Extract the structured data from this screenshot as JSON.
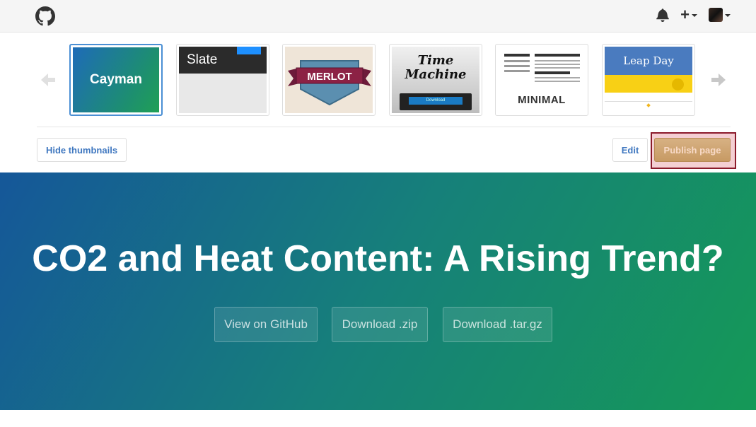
{
  "nav": {
    "logo_icon": "github-octocat-icon",
    "notifications_icon": "bell-icon",
    "new_icon": "plus-icon",
    "avatar_icon": "user-avatar"
  },
  "theme_chooser": {
    "themes": [
      {
        "name": "Cayman",
        "selected": true
      },
      {
        "name": "Slate",
        "selected": false
      },
      {
        "name": "MERLOT",
        "selected": false
      },
      {
        "name_line1": "Time",
        "name_line2": "Machine",
        "button_label": "Download",
        "selected": false
      },
      {
        "name": "MINIMAL",
        "selected": false
      },
      {
        "name": "Leap Day",
        "selected": false
      }
    ],
    "hide_thumbnails_label": "Hide thumbnails",
    "edit_label": "Edit",
    "publish_label": "Publish page"
  },
  "hero": {
    "title": "CO2 and Heat Content: A Rising Trend?",
    "buttons": [
      "View on GitHub",
      "Download .zip",
      "Download .tar.gz"
    ]
  },
  "colors": {
    "hero_start": "#155799",
    "hero_end": "#159957",
    "link_blue": "#4078c0",
    "publish_highlight": "#8b1a2b"
  }
}
